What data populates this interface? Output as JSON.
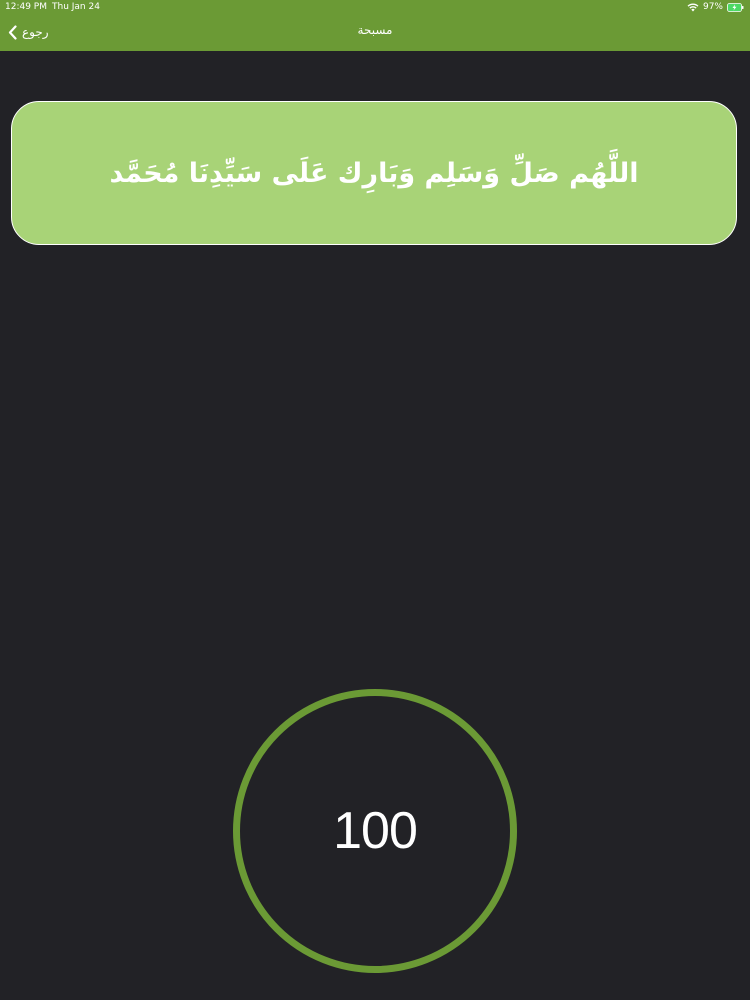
{
  "status_bar": {
    "time": "12:49 PM",
    "date": "Thu Jan 24",
    "battery_percent": "97%"
  },
  "nav": {
    "back_label": "رجوع",
    "title": "مسبحة"
  },
  "dhikr": {
    "text": "اللَّهُم صَلِّ وَسَلِم وَبَارِك عَلَى سَيِّدِنَا مُحَمَّد"
  },
  "counter": {
    "value": "100"
  },
  "colors": {
    "accent_green": "#6b9a35",
    "card_green": "#a8d377",
    "background": "#222226"
  }
}
